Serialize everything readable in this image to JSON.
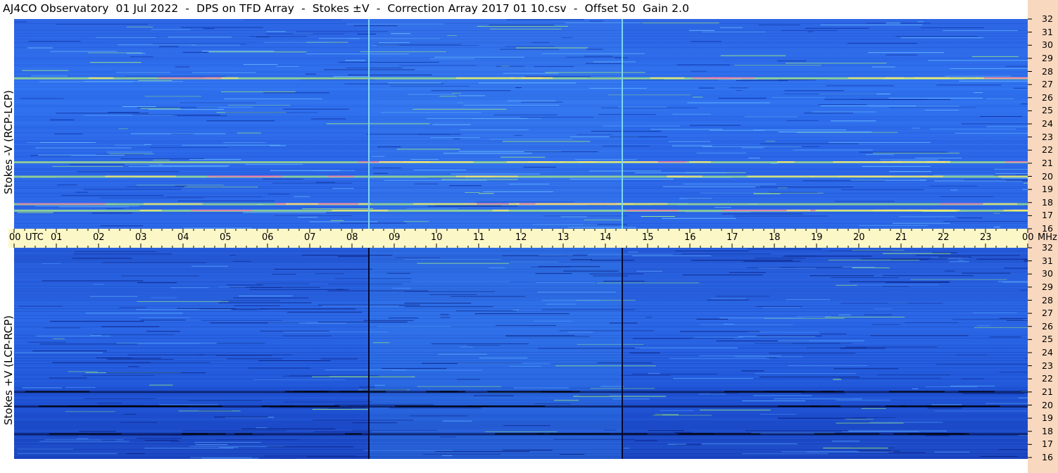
{
  "title": "AJ4CO Observatory  01 Jul 2022  -  DPS on TFD Array  -  Stokes ±V  -  Correction Array 2017 01 10.csv  -  Offset 50  Gain 2.0",
  "colors": {
    "background": "#ffffff",
    "time_bar": "#fcf7c6",
    "freq_strip": "#f8d8be",
    "low": "#0a2a9e",
    "mid": "#2e6ee8",
    "high": "#9ff07a"
  },
  "chart_data": [
    {
      "type": "heatmap",
      "panel": "top",
      "ylabel": "Stokes -V (RCP-LCP)",
      "x_unit": "UTC",
      "y_unit": "MHz",
      "x_ticks": [
        "00",
        "01",
        "02",
        "03",
        "04",
        "05",
        "06",
        "07",
        "08",
        "09",
        "10",
        "11",
        "12",
        "13",
        "14",
        "15",
        "16",
        "17",
        "18",
        "19",
        "20",
        "21",
        "22",
        "23",
        "00"
      ],
      "y_ticks": [
        "32",
        "31",
        "30",
        "29",
        "28",
        "27",
        "26",
        "25",
        "24",
        "23",
        "22",
        "21",
        "20",
        "19",
        "18",
        "17",
        "16"
      ],
      "xlim_hours": [
        0,
        24
      ],
      "ylim_mhz": [
        16,
        32
      ],
      "features": [
        {
          "type": "vertical_line",
          "time_h": 8.4,
          "style": "light"
        },
        {
          "type": "vertical_line",
          "time_h": 14.4,
          "style": "light"
        },
        {
          "type": "horizontal_band",
          "freq_mhz": 17.9,
          "level": "high"
        },
        {
          "type": "horizontal_band",
          "freq_mhz": 17.4,
          "level": "high"
        },
        {
          "type": "horizontal_band",
          "freq_mhz": 20.0,
          "level": "high"
        },
        {
          "type": "horizontal_band",
          "freq_mhz": 21.1,
          "level": "high"
        },
        {
          "type": "horizontal_band",
          "freq_mhz": 27.5,
          "level": "high"
        }
      ]
    },
    {
      "type": "heatmap",
      "panel": "bottom",
      "ylabel": "Stokes +V (LCP-RCP)",
      "x_unit": "UTC",
      "y_unit": "MHz",
      "x_ticks": [
        "00",
        "01",
        "02",
        "03",
        "04",
        "05",
        "06",
        "07",
        "08",
        "09",
        "10",
        "11",
        "12",
        "13",
        "14",
        "15",
        "16",
        "17",
        "18",
        "19",
        "20",
        "21",
        "22",
        "23",
        "00"
      ],
      "y_ticks": [
        "32",
        "31",
        "30",
        "29",
        "28",
        "27",
        "26",
        "25",
        "24",
        "23",
        "22",
        "21",
        "20",
        "19",
        "18",
        "17",
        "16"
      ],
      "xlim_hours": [
        0,
        24
      ],
      "ylim_mhz": [
        16,
        32
      ],
      "features": [
        {
          "type": "vertical_line",
          "time_h": 8.4,
          "style": "dark"
        },
        {
          "type": "vertical_line",
          "time_h": 14.4,
          "style": "dark"
        },
        {
          "type": "horizontal_band",
          "freq_mhz": 17.9,
          "level": "low"
        },
        {
          "type": "horizontal_band",
          "freq_mhz": 20.0,
          "level": "low"
        },
        {
          "type": "horizontal_band",
          "freq_mhz": 21.1,
          "level": "low"
        }
      ]
    }
  ],
  "time_axis": {
    "utc_label": "UTC",
    "mhz_label": "MHz"
  }
}
